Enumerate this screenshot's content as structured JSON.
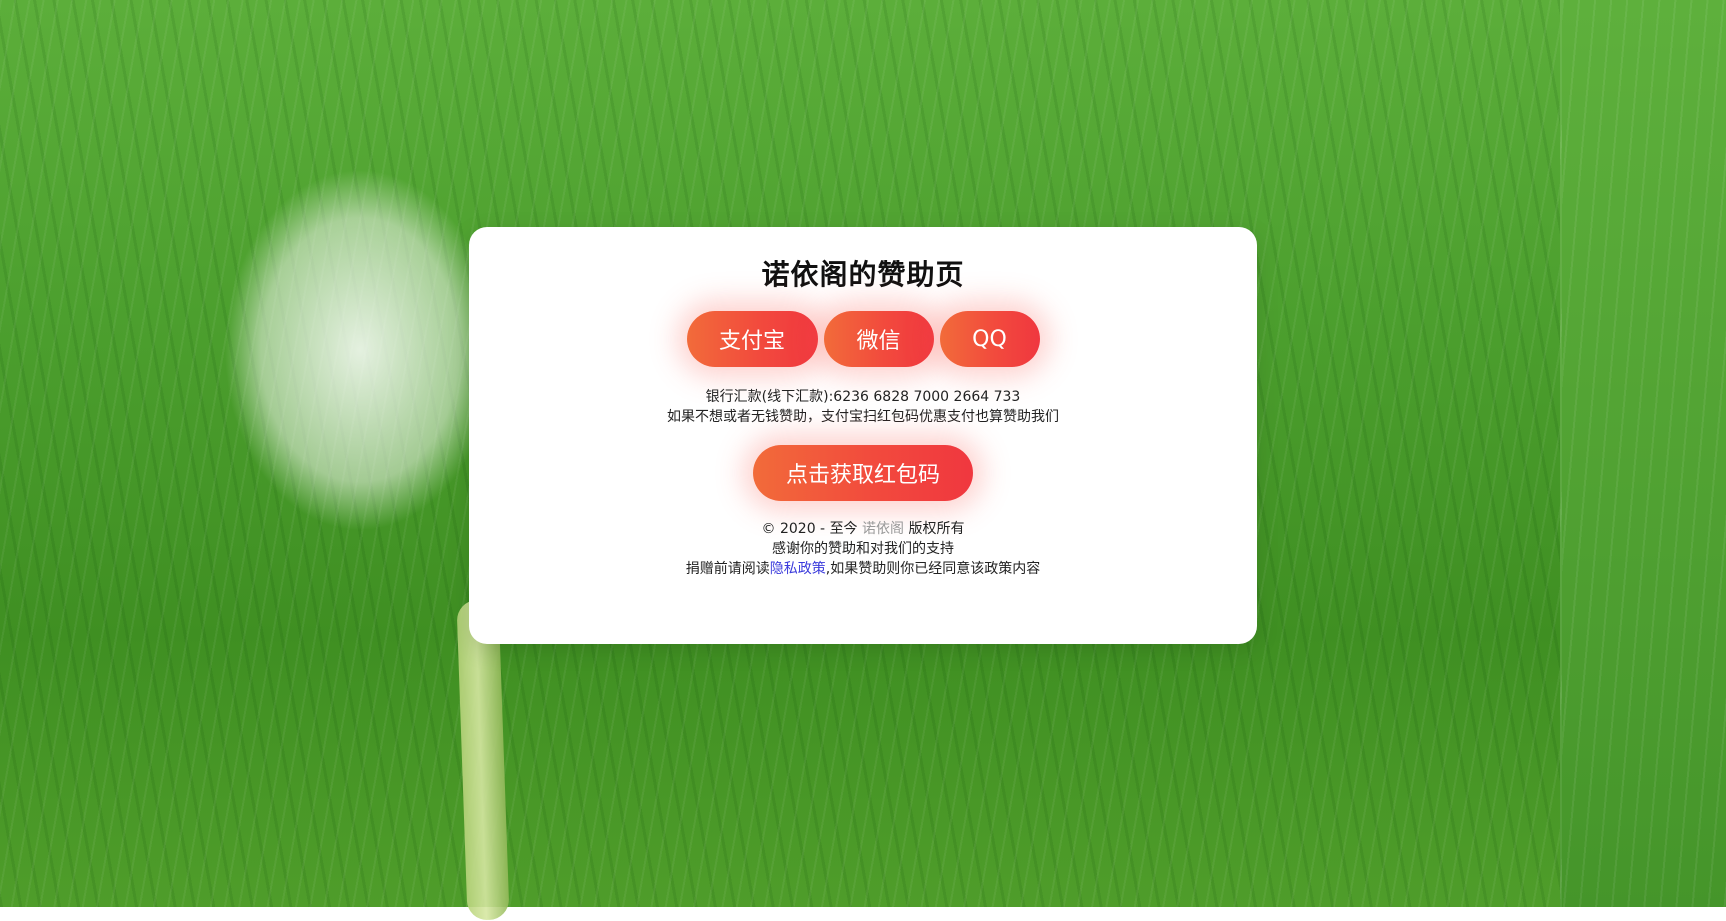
{
  "card": {
    "title": "诺依阁的赞助页",
    "buttons": {
      "alipay": "支付宝",
      "wechat": "微信",
      "qq": "QQ"
    },
    "bank_line": "银行汇款(线下汇款):6236 6828 7000 2664 733",
    "hint_line": "如果不想或者无钱赞助，支付宝扫红包码优惠支付也算赞助我们",
    "cta_label": "点击获取红包码",
    "footer": {
      "copyright_prefix": "© 2020 - 至今",
      "brand": "诺依阁",
      "copyright_suffix": "版权所有",
      "thanks": "感谢你的赞助和对我们的支持",
      "policy_prefix": "捐赠前请阅读",
      "policy_link": "隐私政策",
      "policy_suffix": ",如果赞助则你已经同意该政策内容"
    }
  },
  "colors": {
    "accent_start": "#f26b3a",
    "accent_end": "#f0373f",
    "link": "#3b3bdc",
    "brand_muted": "#999999"
  }
}
